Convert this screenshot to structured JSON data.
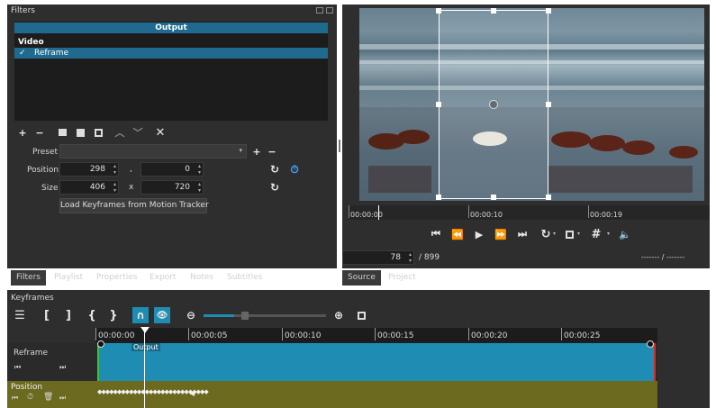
{
  "filters_panel": {
    "title": "Filters",
    "output_header": "Output",
    "video_group": "Video",
    "filter_item": "Reframe",
    "filter_check": "✓"
  },
  "params": {
    "preset_label": "Preset",
    "preset_value": "",
    "position_label": "Position",
    "position_x": "298",
    "position_sep": ",",
    "position_y": "0",
    "size_label": "Size",
    "size_w": "406",
    "size_sep": "x",
    "size_h": "720",
    "motion_button": "Load Keyframes from Motion Tracker"
  },
  "left_tabs": [
    "Filters",
    "Playlist",
    "Properties",
    "Export",
    "Notes",
    "Subtitles"
  ],
  "right_tabs": [
    "Source",
    "Project"
  ],
  "player": {
    "ruler_labels": [
      "00:00:00",
      "00:00:10",
      "00:00:19"
    ],
    "frame_value": "78",
    "frame_total": "/ 899",
    "inout": "------- / -------"
  },
  "keyframes": {
    "title": "Keyframes",
    "ruler_labels": [
      "00:00:00",
      "00:00:05",
      "00:00:10",
      "00:00:15",
      "00:00:20",
      "00:00:25"
    ],
    "track_reframe": "Reframe",
    "clip_label": "Output",
    "track_position": "Position",
    "zoom_level": 0.25
  },
  "colors": {
    "accent": "#1f6a8e",
    "clip": "#1f8db3",
    "param_track": "#6b6a1f",
    "panel": "#2e2e2e"
  }
}
